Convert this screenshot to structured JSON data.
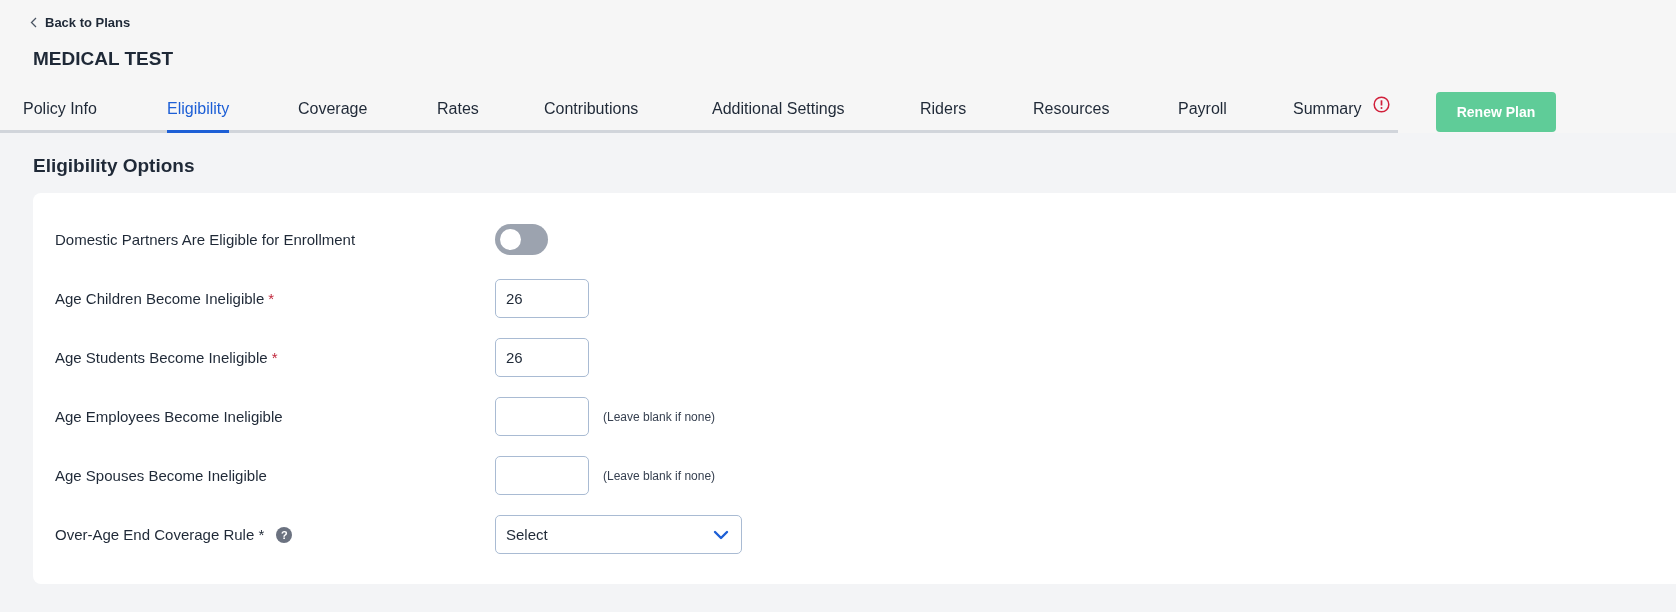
{
  "back_link": {
    "label": "Back to Plans"
  },
  "plan_title": "MEDICAL TEST",
  "tabs": [
    {
      "label": "Policy Info",
      "selected": false
    },
    {
      "label": "Eligibility",
      "selected": true
    },
    {
      "label": "Coverage",
      "selected": false
    },
    {
      "label": "Rates",
      "selected": false
    },
    {
      "label": "Contributions",
      "selected": false
    },
    {
      "label": "Additional Settings",
      "selected": false
    },
    {
      "label": "Riders",
      "selected": false
    },
    {
      "label": "Resources",
      "selected": false
    },
    {
      "label": "Payroll",
      "selected": false
    },
    {
      "label": "Summary",
      "selected": false,
      "alert": true
    }
  ],
  "renew_button": "Renew Plan",
  "section_title": "Eligibility Options",
  "fields": [
    {
      "kind": "toggle",
      "label": "Domestic Partners Are Eligible for Enrollment",
      "on": false
    },
    {
      "kind": "number",
      "label": "Age Children Become Ineligible",
      "required_mark": "*",
      "value": "26"
    },
    {
      "kind": "number",
      "label": "Age Students Become Ineligible",
      "required_mark": "*",
      "value": "26"
    },
    {
      "kind": "number",
      "label": "Age Employees Become Ineligible",
      "hint": "(Leave blank if none)"
    },
    {
      "kind": "number",
      "label": "Age Spouses Become Ineligible",
      "hint": "(Leave blank if none)"
    },
    {
      "kind": "select",
      "label": "Over-Age End Coverage Rule *",
      "help": "?",
      "value": "Select"
    }
  ]
}
